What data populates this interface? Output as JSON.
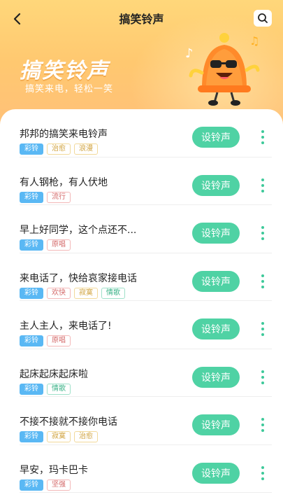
{
  "header": {
    "title": "搞笑铃声"
  },
  "hero": {
    "title": "搞笑铃声",
    "subtitle": "搞笑来电，轻松一笑"
  },
  "colors": {
    "accent": "#4fd2a4",
    "color_ring_tag": "#5ab8f4",
    "hero_bg": "#ffc870"
  },
  "icons": {
    "back": "chevron-left-icon",
    "search": "search-icon",
    "more": "more-vertical-icon",
    "mascot": "bell-mascot-icon"
  },
  "set_label": "设铃声",
  "ringtones": [
    {
      "title": "邦邦的搞笑来电铃声",
      "tags": [
        "彩铃",
        "治愈",
        "浪漫"
      ]
    },
    {
      "title": "有人钢枪，有人伏地",
      "tags": [
        "彩铃",
        "流行"
      ]
    },
    {
      "title": "早上好同学，这个点还不...",
      "tags": [
        "彩铃",
        "原唱"
      ]
    },
    {
      "title": "来电话了，快给哀家接电话",
      "tags": [
        "彩铃",
        "欢快",
        "寂寞",
        "情歌"
      ]
    },
    {
      "title": "主人主人，来电话了!",
      "tags": [
        "彩铃",
        "原唱"
      ]
    },
    {
      "title": "起床起床起床啦",
      "tags": [
        "彩铃",
        "情歌"
      ]
    },
    {
      "title": "不接不接就不接你电话",
      "tags": [
        "彩铃",
        "寂寞",
        "治愈"
      ]
    },
    {
      "title": "早安，玛卡巴卡",
      "tags": [
        "彩铃",
        "坚强"
      ]
    }
  ]
}
